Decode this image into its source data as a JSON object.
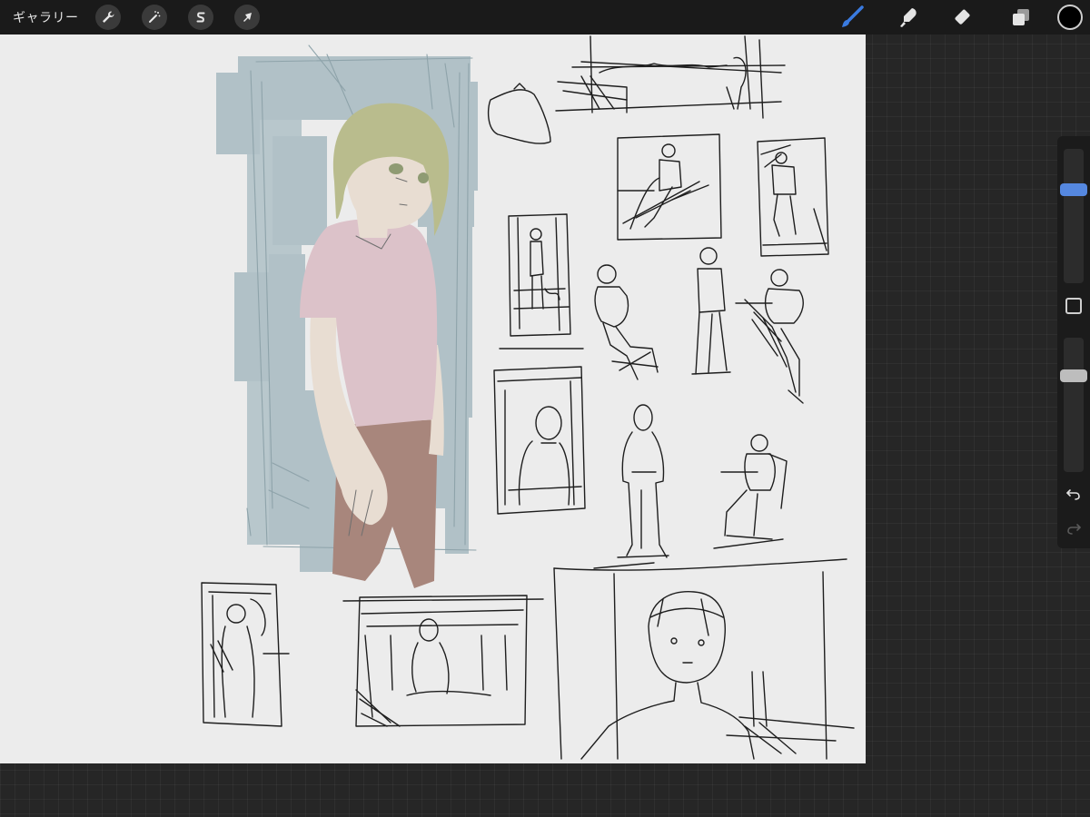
{
  "toolbar": {
    "gallery_label": "ギャラリー",
    "left_tools": [
      {
        "name": "actions",
        "icon": "wrench-icon"
      },
      {
        "name": "adjustments",
        "icon": "magic-wand-icon"
      },
      {
        "name": "selection",
        "icon": "selection-s-icon"
      },
      {
        "name": "transform",
        "icon": "arrow-cursor-icon"
      }
    ],
    "right_tools": [
      {
        "name": "brush",
        "icon": "brush-icon",
        "active": true
      },
      {
        "name": "smudge",
        "icon": "smudge-icon",
        "active": false
      },
      {
        "name": "eraser",
        "icon": "eraser-icon",
        "active": false
      },
      {
        "name": "layers",
        "icon": "layers-icon",
        "active": false
      }
    ],
    "current_color": "#000000",
    "active_tool_color": "#3a7be0"
  },
  "sidebar": {
    "brush_size_level": 0.28,
    "brush_opacity_level": 0.26,
    "undo_icon": "undo-icon",
    "redo_icon": "redo-icon",
    "modify_icon": "square-icon"
  },
  "canvas": {
    "background": "#ececec",
    "content": "sketch-page"
  }
}
